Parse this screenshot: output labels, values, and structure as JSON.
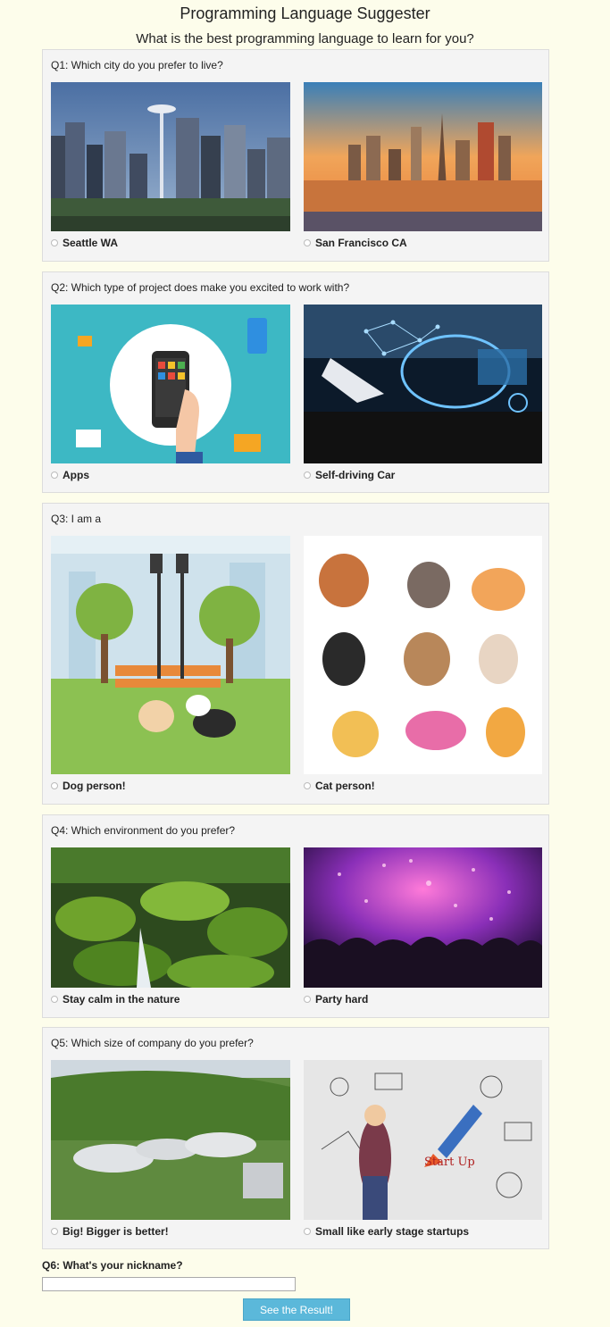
{
  "header": {
    "title": "Programming Language Suggester",
    "subtitle": "What is the best programming language to learn for you?"
  },
  "questions": [
    {
      "label": "Q1: Which city do you prefer to live?",
      "options": [
        {
          "label": "Seattle WA",
          "image": "seattle-skyline"
        },
        {
          "label": "San Francisco CA",
          "image": "san-francisco-skyline"
        }
      ]
    },
    {
      "label": "Q2: Which type of project does make you excited to work with?",
      "options": [
        {
          "label": "Apps",
          "image": "smartphone-apps"
        },
        {
          "label": "Self-driving Car",
          "image": "self-driving-car"
        }
      ]
    },
    {
      "label": "Q3: I am a",
      "options": [
        {
          "label": "Dog person!",
          "image": "dogs-in-park"
        },
        {
          "label": "Cat person!",
          "image": "cats"
        }
      ]
    },
    {
      "label": "Q4: Which environment do you prefer?",
      "options": [
        {
          "label": "Stay calm in the nature",
          "image": "mossy-forest"
        },
        {
          "label": "Party hard",
          "image": "party-crowd"
        }
      ]
    },
    {
      "label": "Q5: Which size of company do you prefer?",
      "options": [
        {
          "label": "Big! Bigger is better!",
          "image": "corporate-campus"
        },
        {
          "label": "Small like early stage startups",
          "image": "startup-sketch"
        }
      ]
    }
  ],
  "q6": {
    "label": "Q6: What's your nickname?",
    "value": "",
    "placeholder": ""
  },
  "submit_label": "See the Result!",
  "colors": {
    "page_bg": "#fdfdeb",
    "box_bg": "#f4f4f4",
    "button_bg": "#5bb8da"
  }
}
